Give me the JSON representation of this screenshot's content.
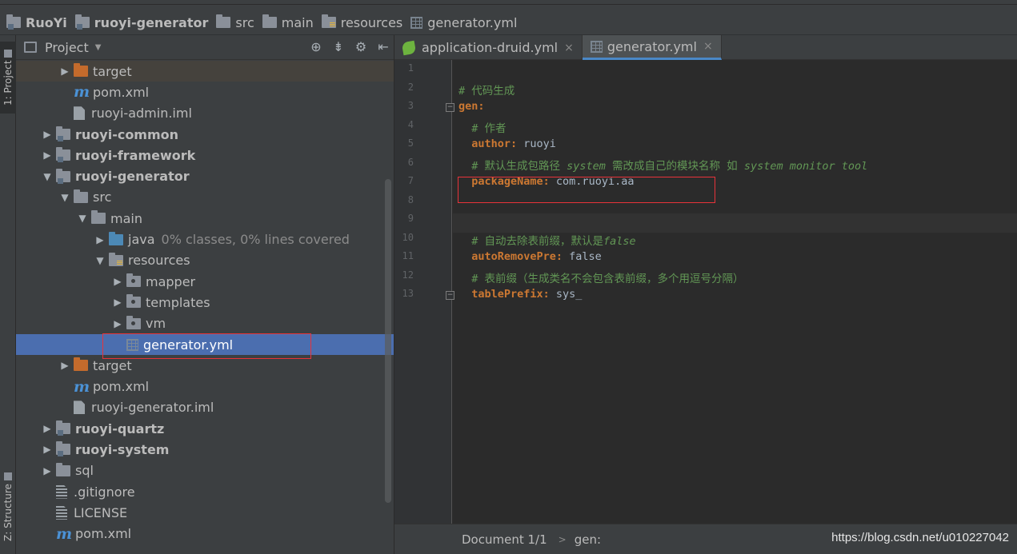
{
  "breadcrumb": [
    "RuoYi",
    "ruoyi-generator",
    "src",
    "main",
    "resources",
    "generator.yml"
  ],
  "left_strip": {
    "project": "1: Project",
    "structure": "Z: Structure"
  },
  "project_panel": {
    "title": "Project",
    "tree": [
      {
        "label": "target",
        "depth": 2,
        "arrow": "closed",
        "icon": "folder-orange",
        "bold": false
      },
      {
        "label": "pom.xml",
        "depth": 2,
        "arrow": "",
        "icon": "maven",
        "bold": false
      },
      {
        "label": "ruoyi-admin.iml",
        "depth": 2,
        "arrow": "",
        "icon": "iml",
        "bold": false
      },
      {
        "label": "ruoyi-common",
        "depth": 1,
        "arrow": "closed",
        "icon": "folder-module",
        "bold": true
      },
      {
        "label": "ruoyi-framework",
        "depth": 1,
        "arrow": "closed",
        "icon": "folder-module",
        "bold": true
      },
      {
        "label": "ruoyi-generator",
        "depth": 1,
        "arrow": "open",
        "icon": "folder-module",
        "bold": true
      },
      {
        "label": "src",
        "depth": 2,
        "arrow": "open",
        "icon": "folder",
        "bold": false
      },
      {
        "label": "main",
        "depth": 3,
        "arrow": "open",
        "icon": "folder",
        "bold": false
      },
      {
        "label": "java",
        "depth": 4,
        "arrow": "closed",
        "icon": "folder-blue",
        "bold": false,
        "coverage": "0% classes, 0% lines covered"
      },
      {
        "label": "resources",
        "depth": 4,
        "arrow": "open",
        "icon": "folder-resources",
        "bold": false
      },
      {
        "label": "mapper",
        "depth": 5,
        "arrow": "closed",
        "icon": "folder-package",
        "bold": false
      },
      {
        "label": "templates",
        "depth": 5,
        "arrow": "closed",
        "icon": "folder-package",
        "bold": false
      },
      {
        "label": "vm",
        "depth": 5,
        "arrow": "closed",
        "icon": "folder-package",
        "bold": false
      },
      {
        "label": "generator.yml",
        "depth": 5,
        "arrow": "",
        "icon": "yml",
        "bold": false,
        "selected": true
      },
      {
        "label": "target",
        "depth": 2,
        "arrow": "closed",
        "icon": "folder-orange",
        "bold": false
      },
      {
        "label": "pom.xml",
        "depth": 2,
        "arrow": "",
        "icon": "maven",
        "bold": false
      },
      {
        "label": "ruoyi-generator.iml",
        "depth": 2,
        "arrow": "",
        "icon": "iml",
        "bold": false
      },
      {
        "label": "ruoyi-quartz",
        "depth": 1,
        "arrow": "closed",
        "icon": "folder-module",
        "bold": true
      },
      {
        "label": "ruoyi-system",
        "depth": 1,
        "arrow": "closed",
        "icon": "folder-module",
        "bold": true
      },
      {
        "label": "sql",
        "depth": 1,
        "arrow": "closed",
        "icon": "folder",
        "bold": false
      },
      {
        "label": ".gitignore",
        "depth": 1,
        "arrow": "",
        "icon": "text",
        "bold": false
      },
      {
        "label": "LICENSE",
        "depth": 1,
        "arrow": "",
        "icon": "text",
        "bold": false
      },
      {
        "label": "pom.xml",
        "depth": 1,
        "arrow": "",
        "icon": "maven",
        "bold": false
      }
    ]
  },
  "tabs": [
    {
      "label": "application-druid.yml",
      "icon": "spring-icon",
      "active": false
    },
    {
      "label": "generator.yml",
      "icon": "yml-icon",
      "active": true
    }
  ],
  "tab_close_glyph": "×",
  "editor": {
    "line_numbers": [
      "1",
      "2",
      "3",
      "4",
      "5",
      "6",
      "7",
      "8",
      "9",
      "10",
      "11",
      "12",
      "13"
    ],
    "lines": [
      {
        "num": "2",
        "parts": [
          {
            "t": "# 代码生成",
            "c": "c-cmt"
          }
        ]
      },
      {
        "num": "3",
        "parts": [
          {
            "t": "gen:",
            "c": "c-key"
          }
        ]
      },
      {
        "num": "4",
        "parts": [
          {
            "t": "  # 作者",
            "c": "c-cmt"
          }
        ]
      },
      {
        "num": "5",
        "parts": [
          {
            "t": "  author:",
            "c": "c-key"
          },
          {
            "t": " ruoyi",
            "c": "c-val"
          }
        ]
      },
      {
        "num": "6",
        "parts": [
          {
            "t": "  # 默认生成包路径 ",
            "c": "c-cmt"
          },
          {
            "t": "system",
            "c": "c-cmt-i"
          },
          {
            "t": " 需改成自己的模块名称 如 ",
            "c": "c-cmt"
          },
          {
            "t": "system monitor tool",
            "c": "c-cmt-i"
          }
        ]
      },
      {
        "num": "7",
        "parts": [
          {
            "t": "  packageName:",
            "c": "c-key"
          },
          {
            "t": " com.ruoyi.aa",
            "c": "c-val"
          }
        ]
      },
      {
        "num": "10",
        "parts": [
          {
            "t": "  # 自动去除表前缀，默认是",
            "c": "c-cmt"
          },
          {
            "t": "false",
            "c": "c-cmt-i"
          }
        ]
      },
      {
        "num": "11",
        "parts": [
          {
            "t": "  autoRemovePre:",
            "c": "c-key"
          },
          {
            "t": " false",
            "c": "c-bool"
          }
        ]
      },
      {
        "num": "12",
        "parts": [
          {
            "t": "  # 表前缀（生成类名不会包含表前缀，多个用逗号分隔）",
            "c": "c-cmt"
          }
        ]
      },
      {
        "num": "13",
        "parts": [
          {
            "t": "  tablePrefix:",
            "c": "c-key"
          },
          {
            "t": " sys_",
            "c": "c-val"
          }
        ]
      }
    ]
  },
  "status": {
    "document": "Document 1/1",
    "path": "gen:"
  },
  "watermark": "https://blog.csdn.net/u010227042",
  "colors": {
    "selection": "#4b6eaf",
    "annotation_red": "#e8333a",
    "keyword": "#cc7832",
    "comment": "#629755"
  }
}
